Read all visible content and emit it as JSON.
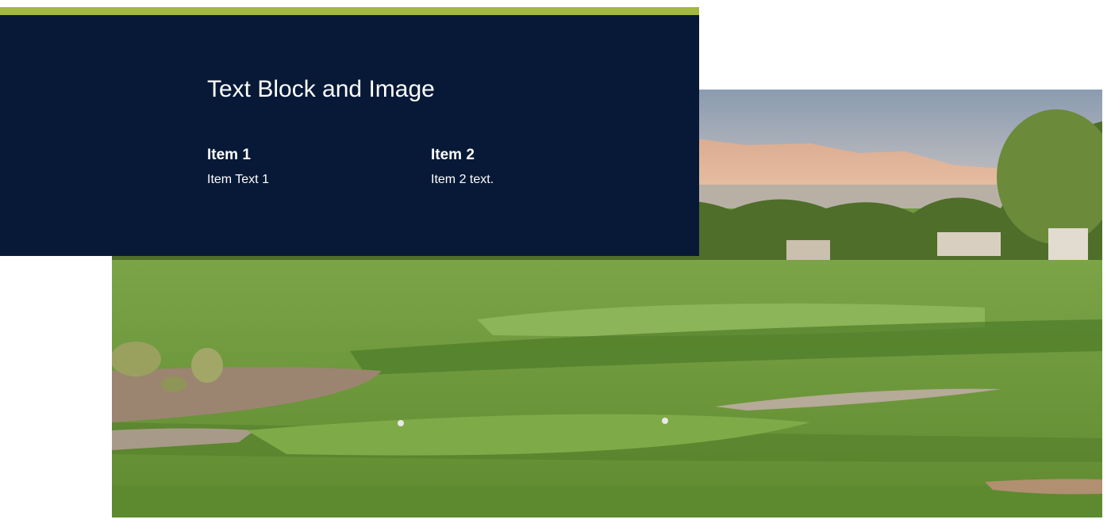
{
  "section": {
    "title": "Text Block and Image",
    "items": [
      {
        "heading": "Item 1",
        "text": "Item Text 1"
      },
      {
        "heading": "Item 2",
        "text": "Item 2 text."
      }
    ]
  },
  "image": {
    "subject": "golf-course-landscape-icon"
  },
  "colors": {
    "panel_background": "#071936",
    "accent_bar": "#a3b83c",
    "text": "#ffffff",
    "page_background": "#ffffff"
  }
}
